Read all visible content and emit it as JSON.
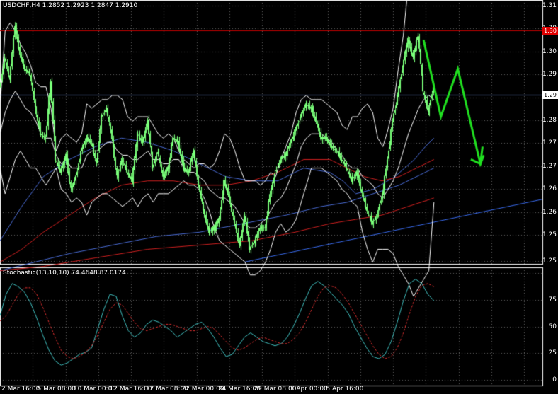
{
  "chart_data": {
    "type": "candlestick",
    "main_panel": {
      "symbol_title": "USDCHF,H4  1.2852 1.2923 1.2847 1.2910",
      "y_ticks": [
        "1.31",
        "1.30",
        "1.30",
        "1.29",
        "1.28",
        "1.28",
        "1.27",
        "1.27",
        "1.26",
        "1.26",
        "1.25",
        "1.25"
      ],
      "ylim": [
        1.2496,
        1.3113
      ],
      "price_flags": [
        {
          "label": "1.30",
          "value": 1.3042,
          "bg": "#e00000",
          "fg": "#ffffff"
        },
        {
          "label": "1.29",
          "value": 1.2892,
          "bg": "#ffffff",
          "fg": "#000000"
        }
      ],
      "horizontal_lines": [
        {
          "value": 1.3042,
          "color": "#c00000"
        },
        {
          "value": 1.2892,
          "color": "#5f7fc8"
        }
      ],
      "close_series": [
        1.2905,
        1.298,
        1.2925,
        1.3055,
        1.2985,
        1.295,
        1.294,
        1.286,
        1.28,
        1.279,
        1.292,
        1.274,
        1.271,
        1.275,
        1.267,
        1.27,
        1.276,
        1.279,
        1.278,
        1.273,
        1.284,
        1.286,
        1.279,
        1.27,
        1.274,
        1.271,
        1.269,
        1.28,
        1.278,
        1.283,
        1.272,
        1.276,
        1.27,
        1.272,
        1.279,
        1.278,
        1.272,
        1.271,
        1.276,
        1.268,
        1.262,
        1.257,
        1.258,
        1.26,
        1.269,
        1.265,
        1.259,
        1.254,
        1.261,
        1.253,
        1.255,
        1.258,
        1.258,
        1.266,
        1.271,
        1.274,
        1.275,
        1.278,
        1.281,
        1.284,
        1.287,
        1.286,
        1.283,
        1.279,
        1.279,
        1.277,
        1.276,
        1.274,
        1.272,
        1.269,
        1.271,
        1.266,
        1.262,
        1.259,
        1.261,
        1.266,
        1.274,
        1.283,
        1.289,
        1.296,
        1.302,
        1.298,
        1.303,
        1.29,
        1.285,
        1.291
      ],
      "bollinger": {
        "upper": [
          1.286,
          1.304,
          1.306,
          1.304,
          1.301,
          1.299,
          1.296,
          1.292,
          1.291,
          1.291,
          1.286,
          1.276,
          1.279,
          1.28,
          1.279,
          1.278,
          1.28,
          1.287,
          1.286,
          1.287,
          1.288,
          1.288,
          1.289,
          1.289,
          1.288,
          1.284,
          1.283,
          1.284,
          1.284,
          1.284,
          1.282,
          1.28,
          1.279,
          1.28,
          1.279,
          1.276,
          1.274,
          1.273,
          1.272,
          1.273,
          1.273,
          1.272,
          1.273,
          1.276,
          1.28,
          1.279,
          1.276,
          1.272,
          1.269,
          1.269,
          1.269,
          1.268,
          1.269,
          1.271,
          1.27,
          1.274,
          1.277,
          1.28,
          1.285,
          1.288,
          1.289,
          1.288,
          1.288,
          1.288,
          1.287,
          1.286,
          1.285,
          1.282,
          1.281,
          1.284,
          1.284,
          1.286,
          1.287,
          1.285,
          1.279,
          1.277,
          1.281,
          1.286,
          1.295,
          1.303,
          1.315,
          1.324,
          1.328,
          1.328,
          1.326,
          1.315
        ],
        "middle": [
          1.28,
          1.285,
          1.288,
          1.29,
          1.288,
          1.286,
          1.285,
          1.283,
          1.28,
          1.279,
          1.279,
          1.275,
          1.273,
          1.274,
          1.272,
          1.272,
          1.272,
          1.275,
          1.276,
          1.276,
          1.277,
          1.278,
          1.278,
          1.276,
          1.275,
          1.275,
          1.274,
          1.274,
          1.275,
          1.276,
          1.274,
          1.274,
          1.273,
          1.273,
          1.274,
          1.274,
          1.272,
          1.271,
          1.271,
          1.27,
          1.269,
          1.267,
          1.266,
          1.265,
          1.265,
          1.264,
          1.263,
          1.261,
          1.259,
          1.258,
          1.258,
          1.259,
          1.26,
          1.262,
          1.264,
          1.265,
          1.267,
          1.27,
          1.273,
          1.277,
          1.279,
          1.28,
          1.28,
          1.28,
          1.279,
          1.278,
          1.276,
          1.275,
          1.273,
          1.272,
          1.272,
          1.27,
          1.269,
          1.268,
          1.266,
          1.265,
          1.267,
          1.269,
          1.272,
          1.276,
          1.28,
          1.283,
          1.286,
          1.288,
          1.289,
          1.288
        ],
        "lower": [
          1.272,
          1.266,
          1.27,
          1.274,
          1.276,
          1.274,
          1.272,
          1.272,
          1.27,
          1.268,
          1.27,
          1.272,
          1.267,
          1.266,
          1.264,
          1.265,
          1.264,
          1.261,
          1.264,
          1.265,
          1.266,
          1.266,
          1.265,
          1.264,
          1.263,
          1.264,
          1.265,
          1.263,
          1.265,
          1.266,
          1.264,
          1.266,
          1.266,
          1.266,
          1.267,
          1.268,
          1.269,
          1.268,
          1.268,
          1.267,
          1.265,
          1.262,
          1.258,
          1.255,
          1.254,
          1.253,
          1.252,
          1.251,
          1.25,
          1.247,
          1.247,
          1.248,
          1.25,
          1.253,
          1.257,
          1.259,
          1.257,
          1.258,
          1.26,
          1.264,
          1.268,
          1.272,
          1.272,
          1.272,
          1.271,
          1.27,
          1.269,
          1.267,
          1.266,
          1.264,
          1.263,
          1.257,
          1.253,
          1.25,
          1.253,
          1.253,
          1.253,
          1.252,
          1.249,
          1.247,
          1.245,
          1.242,
          1.244,
          1.246,
          1.248,
          1.264
        ]
      },
      "moving_averages": [
        {
          "color": "#4a6cd6",
          "x": [
            0.0,
            0.05,
            0.1,
            0.16,
            0.22,
            0.28,
            0.34,
            0.4,
            0.46,
            0.52,
            0.58,
            0.64,
            0.7,
            0.76,
            0.79,
            0.82,
            0.86,
            0.91,
            0.955,
            0.98,
            1.0
          ],
          "values": [
            1.255,
            1.263,
            1.27,
            1.274,
            1.277,
            1.279,
            1.278,
            1.276,
            1.273,
            1.27,
            1.269,
            1.269,
            1.272,
            1.271,
            1.269,
            1.266,
            1.267,
            1.27,
            1.274,
            1.277,
            1.279
          ]
        },
        {
          "color": "#d02020",
          "x": [
            0.0,
            0.05,
            0.1,
            0.16,
            0.22,
            0.28,
            0.34,
            0.4,
            0.46,
            0.52,
            0.58,
            0.64,
            0.7,
            0.76,
            0.8,
            0.84,
            0.88,
            0.92,
            0.96,
            1.0
          ],
          "values": [
            1.25,
            1.253,
            1.257,
            1.261,
            1.265,
            1.268,
            1.269,
            1.269,
            1.268,
            1.268,
            1.269,
            1.271,
            1.274,
            1.274,
            1.272,
            1.27,
            1.269,
            1.27,
            1.272,
            1.274
          ]
        },
        {
          "color": "#4a6cd6",
          "x": [
            0.0,
            0.08,
            0.16,
            0.26,
            0.36,
            0.46,
            0.56,
            0.66,
            0.74,
            0.8,
            0.86,
            0.92,
            1.0
          ],
          "values": [
            1.248,
            1.25,
            1.252,
            1.254,
            1.256,
            1.257,
            1.259,
            1.261,
            1.263,
            1.264,
            1.266,
            1.268,
            1.272
          ]
        },
        {
          "color": "#d02020",
          "x": [
            0.0,
            0.1,
            0.22,
            0.34,
            0.46,
            0.58,
            0.68,
            0.76,
            0.82,
            0.88,
            0.94,
            1.0
          ],
          "values": [
            1.248,
            1.249,
            1.251,
            1.253,
            1.254,
            1.255,
            1.257,
            1.259,
            1.26,
            1.261,
            1.263,
            1.265
          ]
        }
      ],
      "trendline": {
        "color": "#3a6cf0",
        "from_value": 1.25,
        "to_value": 1.2647
      },
      "projection_arrow": {
        "color": "#20e020",
        "path": [
          [
            0.976,
            1.302
          ],
          [
            1.016,
            1.284
          ],
          [
            1.055,
            1.2952
          ],
          [
            1.107,
            1.273
          ],
          [
            1.115,
            1.275
          ]
        ],
        "head": [
          [
            1.085,
            1.274
          ],
          [
            1.107,
            1.273
          ],
          [
            1.112,
            1.277
          ]
        ]
      }
    },
    "stochastic_panel": {
      "title": "Stochastic(13,10,10)  74.4648  87.0174",
      "y_ticks": [
        "100",
        "75",
        "50",
        "25",
        "0"
      ],
      "ylim": [
        -5,
        105
      ],
      "main_color": "#40c0c0",
      "signal_color": "#e03030",
      "main_line": [
        60,
        80,
        90,
        87,
        82,
        72,
        58,
        42,
        28,
        18,
        14,
        16,
        20,
        24,
        26,
        30,
        48,
        66,
        80,
        78,
        60,
        46,
        40,
        44,
        52,
        56,
        54,
        50,
        46,
        40,
        44,
        48,
        52,
        54,
        48,
        40,
        30,
        22,
        24,
        32,
        40,
        44,
        40,
        36,
        34,
        32,
        34,
        40,
        50,
        62,
        76,
        88,
        92,
        88,
        82,
        76,
        70,
        62,
        50,
        40,
        30,
        22,
        20,
        24,
        36,
        54,
        74,
        90,
        94,
        90,
        80,
        74
      ],
      "signal_line": [
        55,
        60,
        70,
        80,
        86,
        86,
        80,
        68,
        54,
        40,
        28,
        22,
        20,
        22,
        26,
        32,
        42,
        54,
        66,
        72,
        70,
        62,
        54,
        48,
        46,
        48,
        50,
        52,
        52,
        50,
        48,
        46,
        46,
        48,
        50,
        48,
        42,
        36,
        30,
        28,
        30,
        34,
        38,
        40,
        38,
        36,
        34,
        34,
        38,
        44,
        54,
        66,
        78,
        86,
        88,
        86,
        80,
        72,
        62,
        52,
        42,
        32,
        24,
        20,
        22,
        30,
        44,
        62,
        78,
        88,
        90,
        87
      ]
    },
    "x_ticks": [
      {
        "label": "2 Mar 16:00",
        "x": 0.0
      },
      {
        "label": "5 Mar 08:00",
        "x": 0.06
      },
      {
        "label": "10 Mar 00:00",
        "x": 0.121
      },
      {
        "label": "12 Mar 16:00",
        "x": 0.181
      },
      {
        "label": "17 Mar 08:00",
        "x": 0.242
      },
      {
        "label": "22 Mar 00:00",
        "x": 0.302
      },
      {
        "label": "24 Mar 16:00",
        "x": 0.363
      },
      {
        "label": "29 Mar 08:00",
        "x": 0.423
      },
      {
        "label": "1 Apr 00:00",
        "x": 0.484
      },
      {
        "label": "5 Apr 16:00",
        "x": 0.544
      }
    ],
    "colors": {
      "background": "#000000",
      "grid": "#606060",
      "candle": "#7aff7a",
      "bollinger": "#ffffff",
      "axis_text": "#ffffff"
    }
  }
}
